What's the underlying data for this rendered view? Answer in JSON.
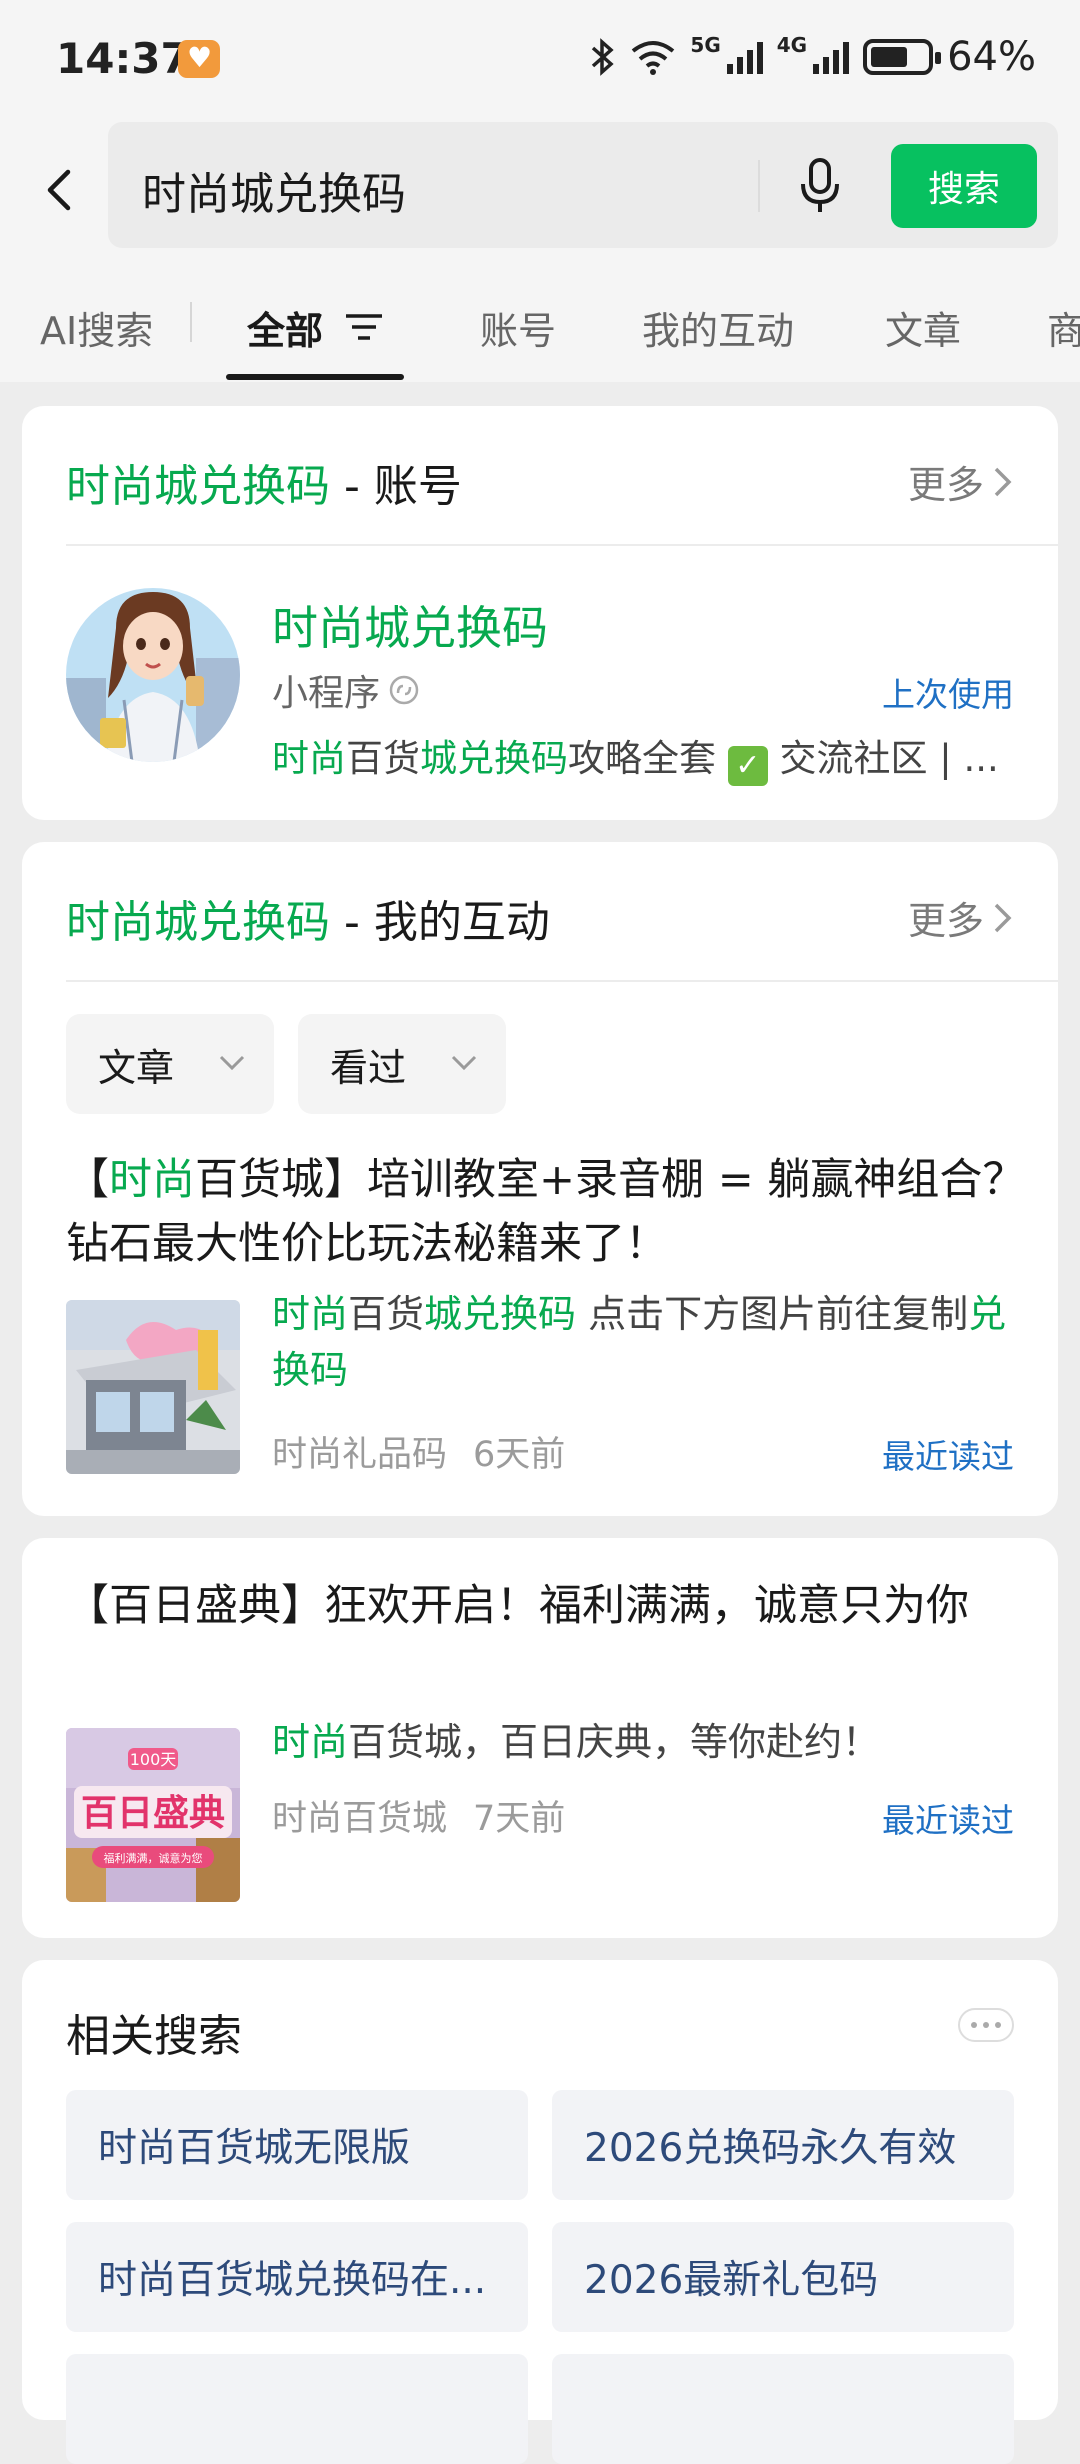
{
  "status_bar": {
    "time": "14:37",
    "net_5g": "5G",
    "net_4g": "4G",
    "battery": "64%"
  },
  "search": {
    "query": "时尚城兑换码",
    "button": "搜索"
  },
  "tabs": [
    {
      "label": "AI搜索"
    },
    {
      "label": "全部"
    },
    {
      "label": "账号"
    },
    {
      "label": "我的互动"
    },
    {
      "label": "文章"
    },
    {
      "label": "商"
    }
  ],
  "account_card": {
    "keyword": "时尚城兑换码",
    "suffix": " - 账号",
    "more": "更多",
    "name": "时尚城兑换码",
    "type": "小程序",
    "last_used": "上次使用",
    "desc_green1": "时尚",
    "desc_plain1": "百货",
    "desc_green2": "城兑换码",
    "desc_plain2": "攻略全套 ",
    "desc_check": "✓",
    "desc_tail": " 交流社区 | ..."
  },
  "interaction_card": {
    "keyword": "时尚城兑换码",
    "suffix": " - 我的互动",
    "more": "更多",
    "filter_type": "文章",
    "filter_status": "看过",
    "article": {
      "title_pre": "【",
      "title_green": "时尚",
      "title_rest": "百货城】培训教室+录音棚 = 躺赢神组合？钻石最大性价比玩法秘籍来了！",
      "desc_green1": "时尚",
      "desc_plain1": "百货",
      "desc_green2": "城兑换码",
      "desc_plain2": " 点击下方图片前往复制",
      "desc_green3": "兑换码",
      "source": "时尚礼品码",
      "time": "6天前",
      "status": "最近读过"
    }
  },
  "article2": {
    "title": "【百日盛典】狂欢开启！福利满满，诚意只为你",
    "desc_green": "时尚",
    "desc_plain": "百货城，百日庆典，等你赴约！",
    "source": "时尚百货城",
    "time": "7天前",
    "status": "最近读过",
    "thumb_badge": "100天",
    "thumb_text": "百日盛典",
    "thumb_sub": "福利满满，诚意为您"
  },
  "related": {
    "title": "相关搜索",
    "items": [
      "时尚百货城无限版",
      "2026兑换码永久有效",
      "时尚百货城兑换码在...",
      "2026最新礼包码"
    ]
  }
}
